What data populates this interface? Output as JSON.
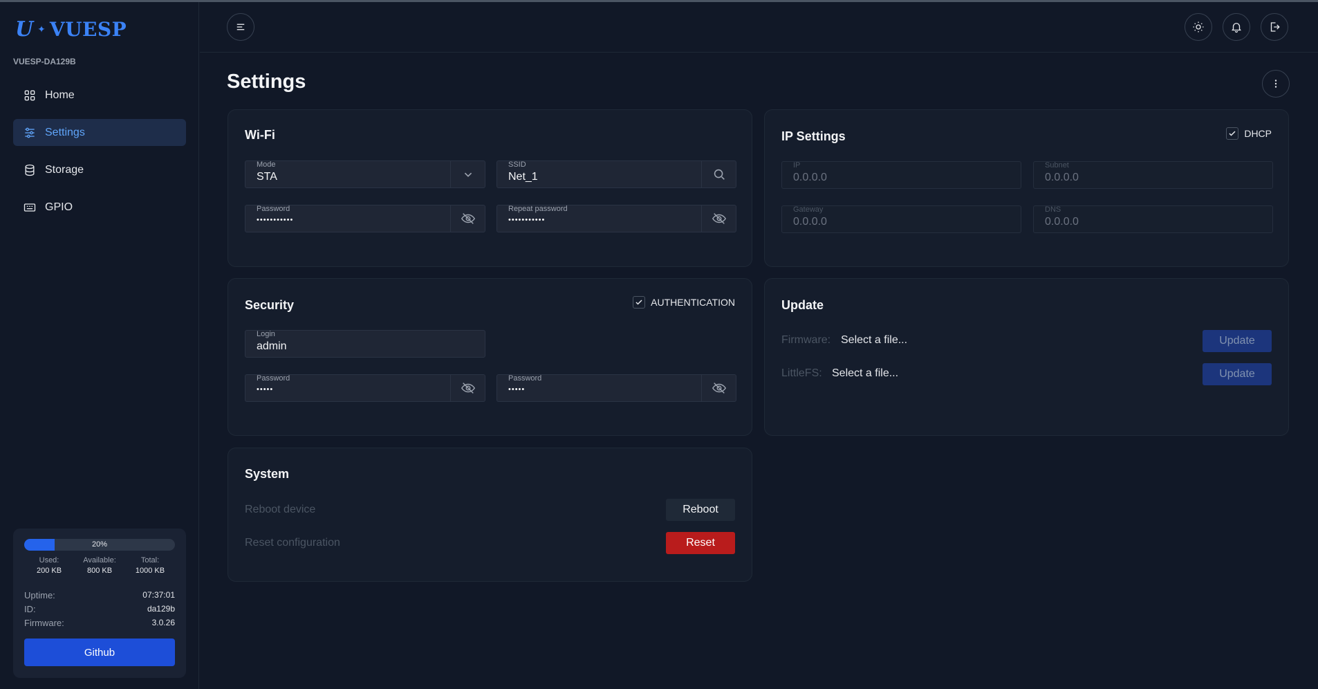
{
  "app": {
    "logo_mark": "U",
    "logo_text": "VUESP",
    "device_name": "VUESP-DA129B"
  },
  "sidebar": {
    "items": [
      {
        "label": "Home",
        "icon": "grid-icon"
      },
      {
        "label": "Settings",
        "icon": "sliders-icon"
      },
      {
        "label": "Storage",
        "icon": "database-icon"
      },
      {
        "label": "GPIO",
        "icon": "chip-icon"
      }
    ],
    "storage": {
      "percent": 20,
      "percent_label": "20%",
      "used_label": "Used:",
      "used": "200 KB",
      "available_label": "Available:",
      "available": "800 KB",
      "total_label": "Total:",
      "total": "1000 KB"
    },
    "info": {
      "uptime_label": "Uptime:",
      "uptime": "07:37:01",
      "id_label": "ID:",
      "id": "da129b",
      "firmware_label": "Firmware:",
      "firmware": "3.0.26"
    },
    "github_label": "Github"
  },
  "page": {
    "title": "Settings"
  },
  "wifi": {
    "title": "Wi-Fi",
    "mode_label": "Mode",
    "mode": "STA",
    "ssid_label": "SSID",
    "ssid": "Net_1",
    "password_label": "Password",
    "password": "•••••••••••",
    "repeat_label": "Repeat password",
    "repeat": "•••••••••••"
  },
  "ip": {
    "title": "IP Settings",
    "dhcp_label": "DHCP",
    "ip_label": "IP",
    "ip": "0.0.0.0",
    "subnet_label": "Subnet",
    "subnet": "0.0.0.0",
    "gateway_label": "Gateway",
    "gateway": "0.0.0.0",
    "dns_label": "DNS",
    "dns": "0.0.0.0"
  },
  "security": {
    "title": "Security",
    "auth_label": "AUTHENTICATION",
    "login_label": "Login",
    "login": "admin",
    "password_label": "Password",
    "password": "•••••",
    "password2_label": "Password",
    "password2": "•••••"
  },
  "update": {
    "title": "Update",
    "firmware_label": "Firmware:",
    "firmware_file": "Select a file...",
    "littlefs_label": "LittleFS:",
    "littlefs_file": "Select a file...",
    "button_label": "Update"
  },
  "system": {
    "title": "System",
    "reboot_label": "Reboot device",
    "reboot_button": "Reboot",
    "reset_label": "Reset configuration",
    "reset_button": "Reset"
  },
  "colors": {
    "accent": "#3b82f6",
    "danger": "#b91c1c",
    "background": "#111827"
  }
}
